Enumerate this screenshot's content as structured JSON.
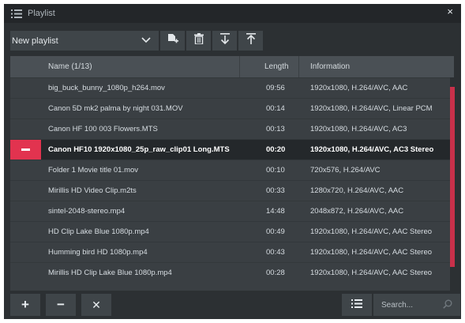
{
  "window": {
    "title": "Playlist",
    "close_label": "×"
  },
  "toolbar": {
    "playlist_select": {
      "value": "New playlist",
      "icon": "chevron-down-icon"
    },
    "buttons": [
      "new-file-icon",
      "trash-icon",
      "move-bottom-icon",
      "move-top-icon"
    ]
  },
  "table": {
    "columns": [
      "Name (1/13)",
      "Length",
      "Information"
    ],
    "rows": [
      {
        "name": "big_buck_bunny_1080p_h264.mov",
        "length": "09:56",
        "info": "1920x1080, H.264/AVC, AAC"
      },
      {
        "name": "Canon 5D mk2 palma by night 031.MOV",
        "length": "00:14",
        "info": "1920x1080, H.264/AVC, Linear PCM"
      },
      {
        "name": "Canon HF 100 003 Flowers.MTS",
        "length": "00:13",
        "info": "1920x1080, H.264/AVC, AC3"
      },
      {
        "name": "Canon HF10 1920x1080_25p_raw_clip01 Long.MTS",
        "length": "00:20",
        "info": "1920x1080, H.264/AVC, AC3 Stereo",
        "active": true
      },
      {
        "name": "Folder 1 Movie title 01.mov",
        "length": "00:10",
        "info": "720x576, H.264/AVC"
      },
      {
        "name": "Mirillis HD Video Clip.m2ts",
        "length": "00:33",
        "info": "1280x720, H.264/AVC, AAC"
      },
      {
        "name": "sintel-2048-stereo.mp4",
        "length": "14:48",
        "info": "2048x872, H.264/AVC, AAC"
      },
      {
        "name": "HD Clip Lake Blue 1080p.mp4",
        "length": "00:49",
        "info": "1920x1080, H.264/AVC, AAC Stereo"
      },
      {
        "name": "Humming bird HD 1080p.mp4",
        "length": "00:43",
        "info": "1920x1080, H.264/AVC, AAC Stereo"
      },
      {
        "name": "Mirillis HD Clip Lake Blue 1080p.mp4",
        "length": "00:28",
        "info": "1920x1080, H.264/AVC, AAC Stereo"
      }
    ]
  },
  "bottombar": {
    "add_label": "+",
    "remove_label": "−",
    "clear_label": "✕",
    "search_placeholder": "Search..."
  },
  "colors": {
    "accent": "#e2334f",
    "background": "#2c3033",
    "header": "#4a5055",
    "row": "#3a3f43",
    "active_row": "#24282b"
  }
}
